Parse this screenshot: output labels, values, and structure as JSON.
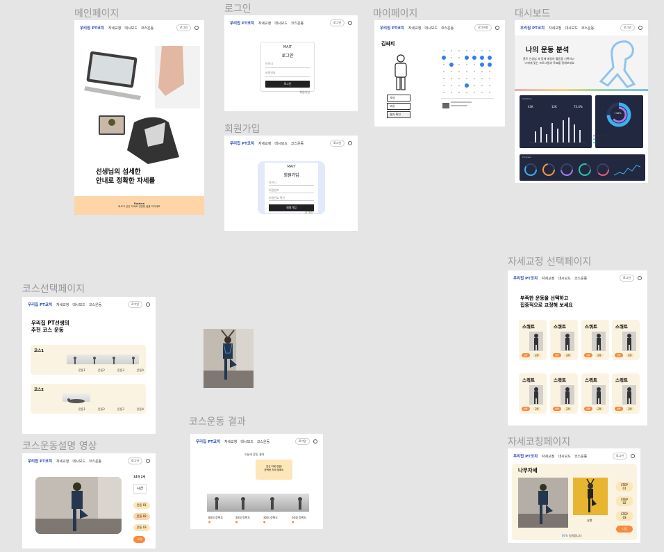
{
  "brand": "우리집 PT코치",
  "menu": [
    "자세교정",
    "대시보드",
    "코스운동"
  ],
  "login_btn": "로그인",
  "frames": {
    "main": {
      "label": "메인페이지",
      "headline1": "선생님의 섬세한",
      "headline2": "안내로 정확한 자세를",
      "footer1": "Posture",
      "footer2": "바르고 곧은 자세로 건강한 삶을 지키세요"
    },
    "login": {
      "label": "로그인",
      "mait": "MAIT",
      "title": "로그인",
      "field1": "아이디",
      "field2": "비밀번호",
      "btn": "로그인",
      "link": "회원가입"
    },
    "signup": {
      "label": "회원가입",
      "mait": "MAIT",
      "title": "회원가입",
      "f1": "아이디",
      "f2": "비밀번호",
      "f3": "비밀번호 확인",
      "btn": "회원가입",
      "link": "로그인"
    },
    "mypage": {
      "label": "마이페이지",
      "name": "김싸피",
      "btn1": "자세",
      "btn2": "코칭",
      "btn3": "결과 확인",
      "pill": "로그아웃"
    },
    "dashboard": {
      "label": "대시보드",
      "title": "나의 운동 분석",
      "desc1": "홈트 선생님 과 함께 매일의 활동을 기록하고",
      "desc2": "나에게 맞는 프로그램과 목표를 정해보세요",
      "s1": "43K",
      "s2": "12K",
      "s3": "73.4%",
      "donut": "+18%",
      "panel1": "Statistics",
      "panel2": "Progress",
      "leg1": "Total Activities",
      "leg2": "Goals",
      "leg3": "Achieved"
    },
    "posture_select": {
      "label": "자세교정 선택페이지",
      "title1": "부족한 운동을 선택하고",
      "title2": "집중적으로 교정해 보세요",
      "card": "스쿼트",
      "b1": "설명",
      "b2": "교정"
    },
    "course_select": {
      "label": "코스선택페이지",
      "title1": "우리집 PT선생의",
      "title2": "추천 코스 운동",
      "course1": "코스1",
      "course2": "코스2",
      "ex": [
        "운동1",
        "운동2",
        "운동3",
        "운동4"
      ]
    },
    "coaching": {
      "label": "자세코칭페이지",
      "title": "나무자세",
      "caption": "실행",
      "steps": [
        "STEP 01",
        "STEP 02",
        "STEP 03"
      ],
      "next": "다음",
      "rate": "80%",
      "rate_text": "일치합니다"
    },
    "course_video": {
      "label": "코스운동설명 영상",
      "count": "14개 2세",
      "time": "시간",
      "b1": "운동 01",
      "b2": "운동 02",
      "b3": "운동 03",
      "go": "시작"
    },
    "course_result": {
      "label": "코스운동 결과",
      "result_title": "오늘의 운동 결과",
      "msg1": "전신 자세 연습!",
      "msg2": "완벽한 자세 정확도",
      "r": [
        "80회 정확도",
        "30회 정확도",
        "30회 정확도",
        "30회 정확도"
      ]
    }
  },
  "colors": {
    "brand": "#2448b5",
    "accent": "#f58b3c",
    "cream": "#fbf3e1",
    "peach": "#fdd5a8",
    "blue": "#2f80ed",
    "navy": "#22283f"
  }
}
